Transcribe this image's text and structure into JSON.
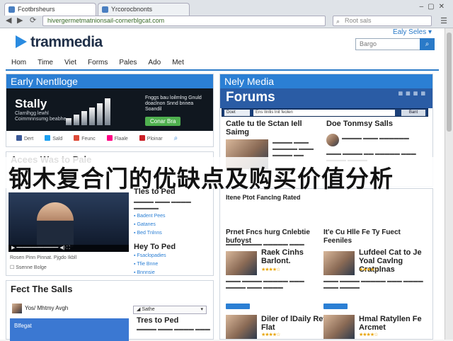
{
  "browser": {
    "tabs": [
      {
        "label": "Fcotbrsheurs"
      },
      {
        "label": "Yrcorocbnonts"
      }
    ],
    "url": "hivergermetmatnionsail-cornerblgcat.com",
    "search_placeholder": "Root sals",
    "back_icon": "back-arrow-icon",
    "forward_icon": "forward-arrow-icon",
    "reload_icon": "reload-icon"
  },
  "site": {
    "logo_text": "trammedia",
    "tagline": "Ealy Seles ▾",
    "search_placeholder": "Bargo",
    "nav": [
      "Hom",
      "Time",
      "Viet",
      "Forms",
      "Pales",
      "Ado",
      "Met"
    ]
  },
  "left_panel": {
    "title": "Early Nentlloge",
    "hero_title": "Stally",
    "hero_sub": "Clarnlhgg lewhl Coimmnnsumg beabhe",
    "hero_right": "Fnggs bau loilrnlng Gnuld doaclnon Snnd bnnea Soandil",
    "hero_button": "Conar Bra",
    "socials": [
      "Dert",
      "Sald",
      "Feunc",
      "Flaale",
      "Ploinar"
    ]
  },
  "right_panel": {
    "title": "Nely Media",
    "forums_title": "Forums",
    "forums_select": "Doet",
    "forums_input": "Ens Ilnllis lnit feolen",
    "forums_button": "Bant",
    "card1_title": "Catle tu tle Sctan Iell Saimg",
    "card2_title": "Doe Tonmsy Salls"
  },
  "overlay_text": "钢木复合门的优缺点及购买价值分析",
  "lower_left": {
    "section_title": "Acees Was to Pale",
    "video_caption": "Rosen Pinn Pinnat. Pjgdo Ikbll",
    "side_head": "Tles to Ped",
    "side_items": [
      "Badent Pees",
      "Gatanes",
      "Bed Tnlnns"
    ],
    "head2": "Hey To Ped",
    "head2_items": [
      "Fsaclopadies",
      "Tfie Bnne",
      "Bnnnsie"
    ],
    "sub_meta": "Ssenne Bolge"
  },
  "middle_col": {
    "head": "Itene Ptot Fanclng Rated",
    "items": [
      {
        "title": "Raek Cinhs Barlont.",
        "stars": "★★★★☆"
      },
      {
        "title": "Diler of lDaily Ret Flat",
        "stars": "★★★★☆"
      }
    ],
    "top_title": "Prnet Fncs hurg Cnlebtie bufoyst"
  },
  "right_col": {
    "head": "It'e Cu Hlle Fe Ty Fuect Feeniles",
    "items": [
      {
        "title": "Lufdeel Cat to Je Yoal Cavlng Cratplnas",
        "stars": "★★★★☆"
      },
      {
        "title": "Hmal Ratyllen Fe Arcmet",
        "stars": "★★★★☆"
      }
    ]
  },
  "bottom_left": {
    "title": "Fect The Salls",
    "user_line": "Yos/ Mhtmy Avgh",
    "dropdown": "Sathe",
    "blue_box_title": "Blfegat",
    "side_title": "Tres to Ped"
  },
  "colors": {
    "accent": "#2b7fd4",
    "header_dark": "#1b3f78",
    "logo": "#1f2f48"
  }
}
